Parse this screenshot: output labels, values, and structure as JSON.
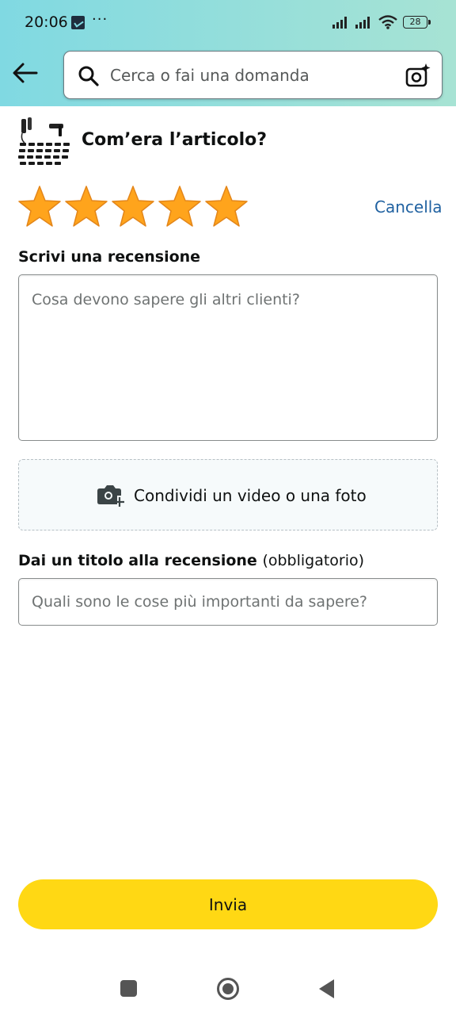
{
  "status_bar": {
    "time": "20:06",
    "dots": "···",
    "battery": "28"
  },
  "search": {
    "placeholder": "Cerca o fai una domanda"
  },
  "product": {
    "question": "Com’era l’articolo?"
  },
  "rating": {
    "stars": 5,
    "max": 5,
    "cancel_label": "Cancella",
    "star_color": "#ffa41c"
  },
  "review": {
    "label": "Scrivi una recensione",
    "placeholder": "Cosa devono sapere gli altri clienti?"
  },
  "media": {
    "label": "Condividi un video o una foto"
  },
  "title_field": {
    "label": "Dai un titolo alla recensione",
    "required_note": "(obbligatorio)",
    "placeholder": "Quali sono le cose più importanti da sapere?"
  },
  "submit": {
    "label": "Invia",
    "color": "#ffd814"
  },
  "colors": {
    "link": "#2162a1",
    "header_gradient_start": "#80d9e2",
    "header_gradient_end": "#a7e3d4"
  }
}
